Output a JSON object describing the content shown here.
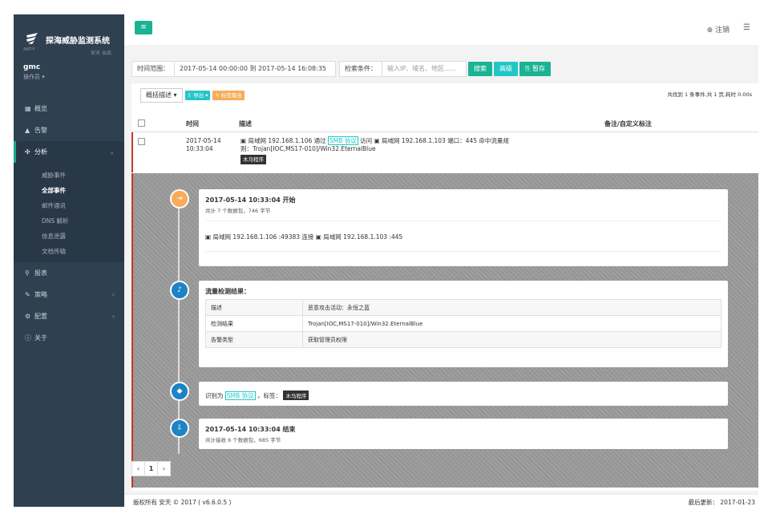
{
  "app": {
    "name": "探海威胁监测系统",
    "subtitle": "安天 出品",
    "logo_sub": "ANTIY"
  },
  "user": {
    "name": "gmc",
    "role": "操作员 ▾"
  },
  "nav": {
    "items": [
      {
        "label": "概览",
        "icon": "dashboard-icon",
        "glyph": "▦"
      },
      {
        "label": "告警",
        "icon": "warning-icon",
        "glyph": "▲"
      },
      {
        "label": "分析",
        "icon": "analysis-icon",
        "glyph": "✣",
        "caret": "⌄"
      }
    ],
    "sub_items": [
      "威胁事件",
      "全部事件",
      "邮件通讯",
      "DNS 解析",
      "信息泄露",
      "文档传输"
    ],
    "lower_items": [
      {
        "label": "报表",
        "icon": "search-icon",
        "glyph": "⚲"
      },
      {
        "label": "策略",
        "icon": "wrench-icon",
        "glyph": "✎",
        "caret": "‹"
      },
      {
        "label": "配置",
        "icon": "settings-icon",
        "glyph": "⚙",
        "caret": "‹"
      },
      {
        "label": "关于",
        "icon": "info-icon",
        "glyph": "ⓘ"
      }
    ]
  },
  "topbar": {
    "menu_glyph": "≡",
    "logout_label": "⊕ 注销",
    "menu_icon_glyph": "☰"
  },
  "search": {
    "time_label": "时间范围：",
    "time_value": "2017-05-14 00:00:00 到 2017-05-14 16:08:35",
    "cond_label": "检索条件：",
    "cond_placeholder": "输入IP、域名、地区......",
    "search_btn": "搜索",
    "advanced_btn": "高级",
    "save_btn": "⎘ 暂存"
  },
  "toolbar": {
    "view_select": "概括描述 ▾",
    "export_tag": "⇩ 导出 ▾",
    "merge_tag": "✎ 标签聚合"
  },
  "result_summary": "共找到 1 条事件,共 1 页,耗时 0.00s",
  "table": {
    "headers": {
      "time": "时间",
      "desc": "描述",
      "note": "备注/自定义标注"
    },
    "row": {
      "date": "2017-05-14",
      "time": "10:33:04",
      "desc_1": "局域网 192.168.1.106 通过",
      "protocol": "SMB 协议",
      "desc_2": "访问",
      "desc_3": "局域网 192.168.1.103 端口：445 命中流量规",
      "desc_4": "则：Trojan[IOC,MS17-010]/Win32.EternalBlue",
      "label": "木马程序"
    }
  },
  "timeline": {
    "start": {
      "title": "2017-05-14 10:33:04 开始",
      "sub": "共计 7 个数据包，746 字节",
      "conn": "局域网 192.168.1.106 :49383 连接",
      "conn_dst": "局域网 192.168.1.103 :445"
    },
    "detect": {
      "title": "流量检测结果：",
      "rows": [
        {
          "k": "描述",
          "v": "恶意攻击活动：永恒之蓝"
        },
        {
          "k": "检测结果",
          "v": "Trojan[IOC,MS17-010]/Win32.EternalBlue"
        },
        {
          "k": "告警类型",
          "v": "获取管理员权限"
        }
      ]
    },
    "identify": {
      "prefix": "识别为",
      "protocol": "SMB 协议",
      "mid": "，标签：",
      "label": "木马程序"
    },
    "end": {
      "title": "2017-05-14 10:33:04 结束",
      "sub": "共计接收 6 个数据包，685 字节"
    }
  },
  "pager": {
    "prev": "‹",
    "page": "1",
    "next": "›"
  },
  "footer": {
    "copyright": "版权所有 安天 © 2017 ( v6.6.0.5 )",
    "updated": "最后更新：  2017-01-23"
  },
  "colors": {
    "sidebar": "#2f4050",
    "primary": "#1ab394",
    "info": "#23c6c8",
    "warning": "#f8ac59",
    "danger": "#c0392b"
  }
}
